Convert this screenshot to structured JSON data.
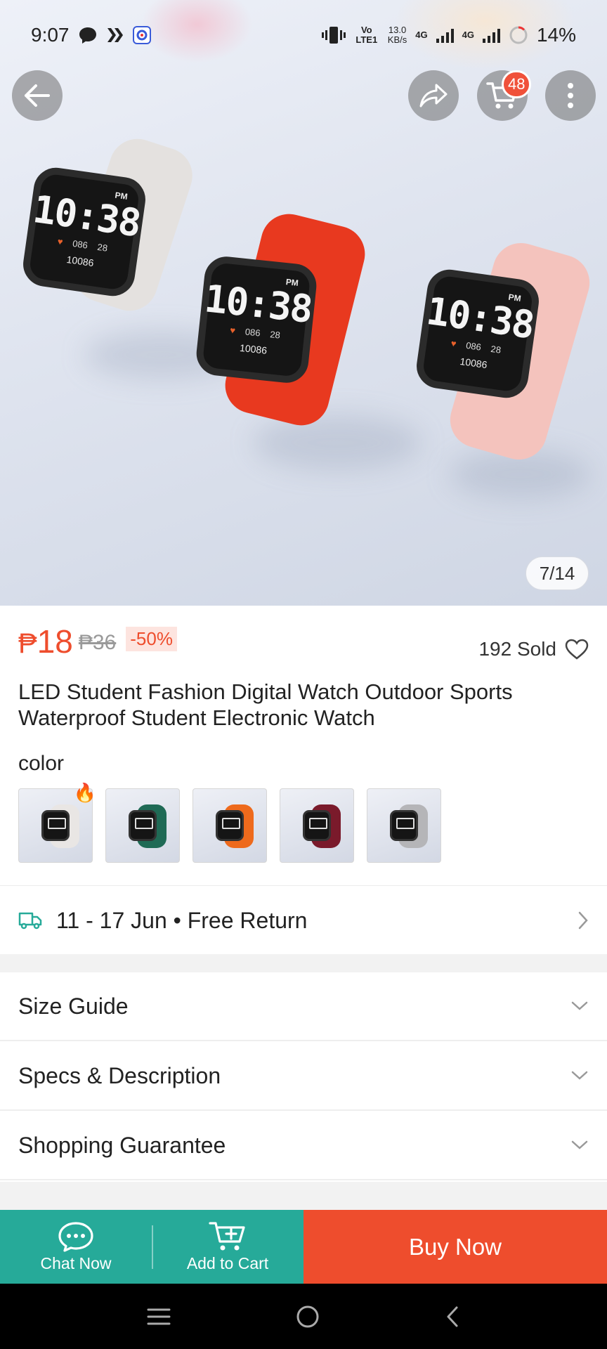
{
  "status_bar": {
    "time": "9:07",
    "volte": "Vo LTE1",
    "speed_value": "13.0",
    "speed_unit": "KB/s",
    "net1": "4G",
    "net2": "4G",
    "battery": "14%"
  },
  "top_actions": {
    "cart_badge": "48"
  },
  "hero": {
    "image_counter": "7/14",
    "watch_time": "10:38",
    "watch_pm": "PM",
    "watch_num1": "086",
    "watch_num2": "28",
    "watch_steps": "10086"
  },
  "product": {
    "price_currency": "₱",
    "price": "18",
    "old_price": "₱36",
    "discount": "-50%",
    "sold": "192 Sold",
    "title": "LED Student Fashion Digital Watch Outdoor Sports Waterproof Student Electronic Watch",
    "color_label": "color",
    "swatches": [
      {
        "strap": "#e9e6e4",
        "hot": true
      },
      {
        "strap": "#1f6a55",
        "hot": false
      },
      {
        "strap": "#ee6a1c",
        "hot": false
      },
      {
        "strap": "#7a1a2b",
        "hot": false
      },
      {
        "strap": "#b5b5b8",
        "hot": false
      }
    ]
  },
  "delivery": {
    "text": "11 - 17 Jun • Free Return"
  },
  "accordions": [
    {
      "label": "Size Guide"
    },
    {
      "label": "Specs & Description"
    },
    {
      "label": "Shopping Guarantee"
    }
  ],
  "action_bar": {
    "chat_label": "Chat Now",
    "cart_label": "Add to Cart",
    "buy_label": "Buy Now"
  },
  "colors": {
    "brand_orange": "#ee4d2d",
    "teal": "#26aa99"
  }
}
